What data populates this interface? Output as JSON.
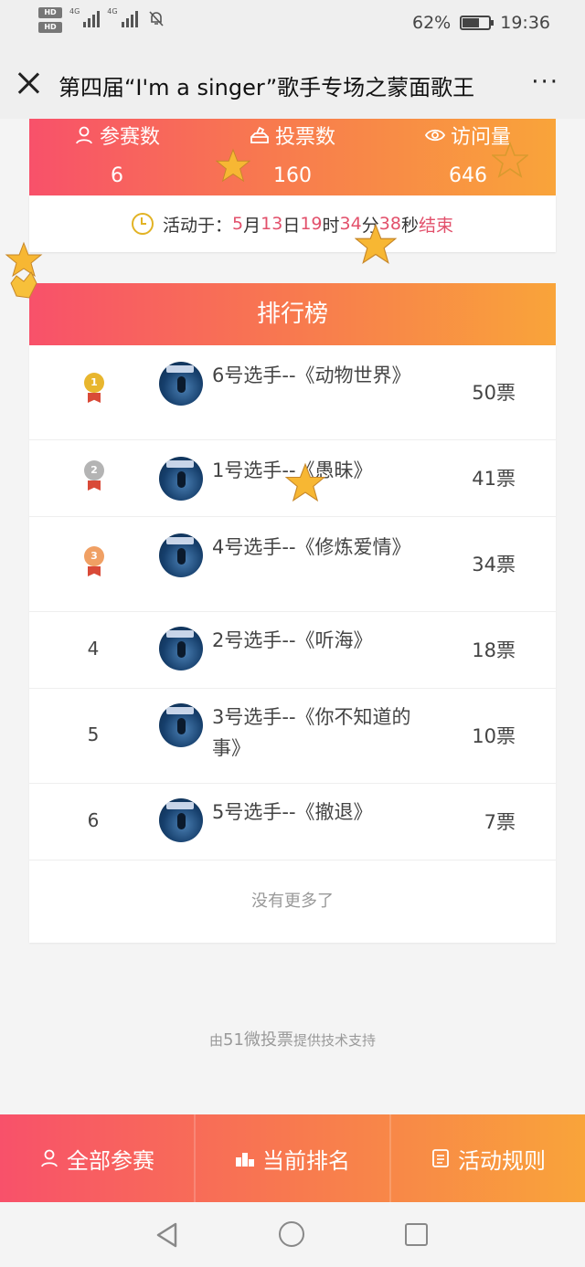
{
  "status_bar": {
    "hd1": "HD",
    "hd2": "HD",
    "net1": "4G",
    "net2": "4G",
    "battery": "62%",
    "battery_level": 0.62,
    "time": "19:36"
  },
  "title_bar": {
    "title": "第四届“I'm a singer”歌手专场之蒙面歌王",
    "more": "···"
  },
  "stats": [
    {
      "label": "参赛数",
      "value": "6"
    },
    {
      "label": "投票数",
      "value": "160"
    },
    {
      "label": "访问量",
      "value": "646"
    }
  ],
  "timer": {
    "prefix": "活动于：",
    "month": "5",
    "month_unit": "月",
    "day": "13",
    "day_unit": "日",
    "hour": "19",
    "hour_unit": "时",
    "minute": "34",
    "minute_unit": "分",
    "second": "38",
    "second_unit": "秒",
    "suffix": "结束"
  },
  "ranking": {
    "title": "排行榜",
    "items": [
      {
        "rank": "1",
        "name": "6号选手--《动物世界》",
        "votes": "50票"
      },
      {
        "rank": "2",
        "name": "1号选手--《愚昧》",
        "votes": "41票"
      },
      {
        "rank": "3",
        "name": "4号选手--《修炼爱情》",
        "votes": "34票"
      },
      {
        "rank": "4",
        "name": "2号选手--《听海》",
        "votes": "18票"
      },
      {
        "rank": "5",
        "name": "3号选手--《你不知道的事》",
        "votes": "10票"
      },
      {
        "rank": "6",
        "name": "5号选手--《撤退》",
        "votes": "7票"
      }
    ],
    "no_more": "没有更多了"
  },
  "support": {
    "pre": "由",
    "brand": "51微投票",
    "post": "提供技术支持"
  },
  "tabs": [
    {
      "label": "全部参赛",
      "icon": "user-icon"
    },
    {
      "label": "当前排名",
      "icon": "podium-icon"
    },
    {
      "label": "活动规则",
      "icon": "document-icon"
    }
  ],
  "colors": {
    "gradient_start": "#f8516a",
    "gradient_end": "#f9a43a",
    "highlight": "#e2506b",
    "gold": "#e8b62e",
    "silver": "#b4b4b4",
    "bronze": "#f0a064"
  }
}
